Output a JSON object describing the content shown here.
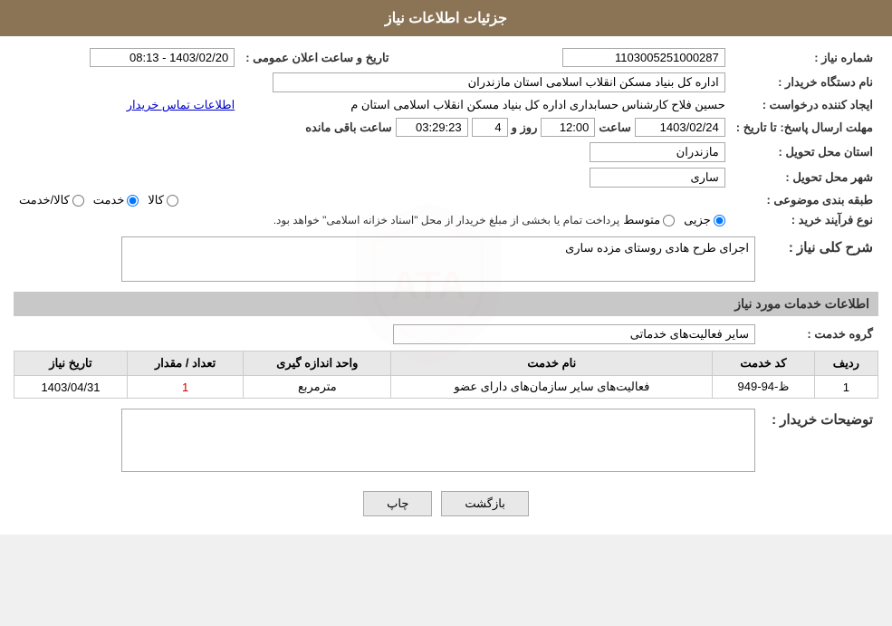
{
  "header": {
    "title": "جزئیات اطلاعات نیاز"
  },
  "fields": {
    "shomareNiaz_label": "شماره نیاز :",
    "shomareNiaz_value": "1103005251000287",
    "namDastgah_label": "نام دستگاه خریدار :",
    "namDastgah_value": "اداره کل بنیاد مسکن انقلاب اسلامی استان مازندران",
    "ijadKonande_label": "ایجاد کننده درخواست :",
    "ijadKonande_value": "حسین فلاح کارشناس حسابداری اداره کل بنیاد مسکن انقلاب اسلامی استان م",
    "etelaatTamas_label": "اطلاعات تماس خریدار",
    "tarikhLabel": "تاریخ و ساعت اعلان عمومی :",
    "tarikhValue": "1403/02/20 - 08:13",
    "mohlat_label": "مهلت ارسال پاسخ: تا تاریخ :",
    "mohlat_date": "1403/02/24",
    "mohlat_saat_label": "ساعت",
    "mohlat_saat": "12:00",
    "mohlat_roz_label": "روز و",
    "mohlat_roz": "4",
    "mohlat_mande_label": "ساعت باقی مانده",
    "mohlat_mande": "03:29:23",
    "ostan_label": "استان محل تحویل :",
    "ostan_value": "مازندران",
    "shahr_label": "شهر محل تحویل :",
    "shahr_value": "ساری",
    "tabaqe_label": "طبقه بندی موضوعی :",
    "tabaqe_options": [
      "کالا",
      "خدمت",
      "کالا/خدمت"
    ],
    "tabaqe_selected": "خدمت",
    "noeFarayand_label": "نوع فرآیند خرید :",
    "noeFarayand_options": [
      "جزیی",
      "متوسط"
    ],
    "noeFarayand_selected": "جزیی",
    "noeFarayand_note": "پرداخت تمام یا بخشی از مبلغ خریدار از محل \"اسناد خزانه اسلامی\" خواهد بود.",
    "sharhKoli_label": "شرح کلی نیاز :",
    "sharhKoli_value": "اجرای طرح هادی روستای مزده ساری",
    "section_services": "اطلاعات خدمات مورد نیاز",
    "groheKhadamat_label": "گروه خدمت :",
    "groheKhadamat_value": "سایر فعالیت‌های خدماتی",
    "table_headers": [
      "ردیف",
      "کد خدمت",
      "نام خدمت",
      "واحد اندازه گیری",
      "تعداد / مقدار",
      "تاریخ نیاز"
    ],
    "table_rows": [
      {
        "radif": "1",
        "kodKhadamat": "ظ-94-949",
        "namKhadamat": "فعالیت‌های سایر سازمان‌های دارای عضو",
        "vahedAndaze": "مترمربع",
        "tedad": "1",
        "tarikhNiaz": "1403/04/31"
      }
    ],
    "tozihat_label": "توضیحات خریدار :",
    "tozihat_value": "",
    "btn_print": "چاپ",
    "btn_back": "بازگشت"
  }
}
